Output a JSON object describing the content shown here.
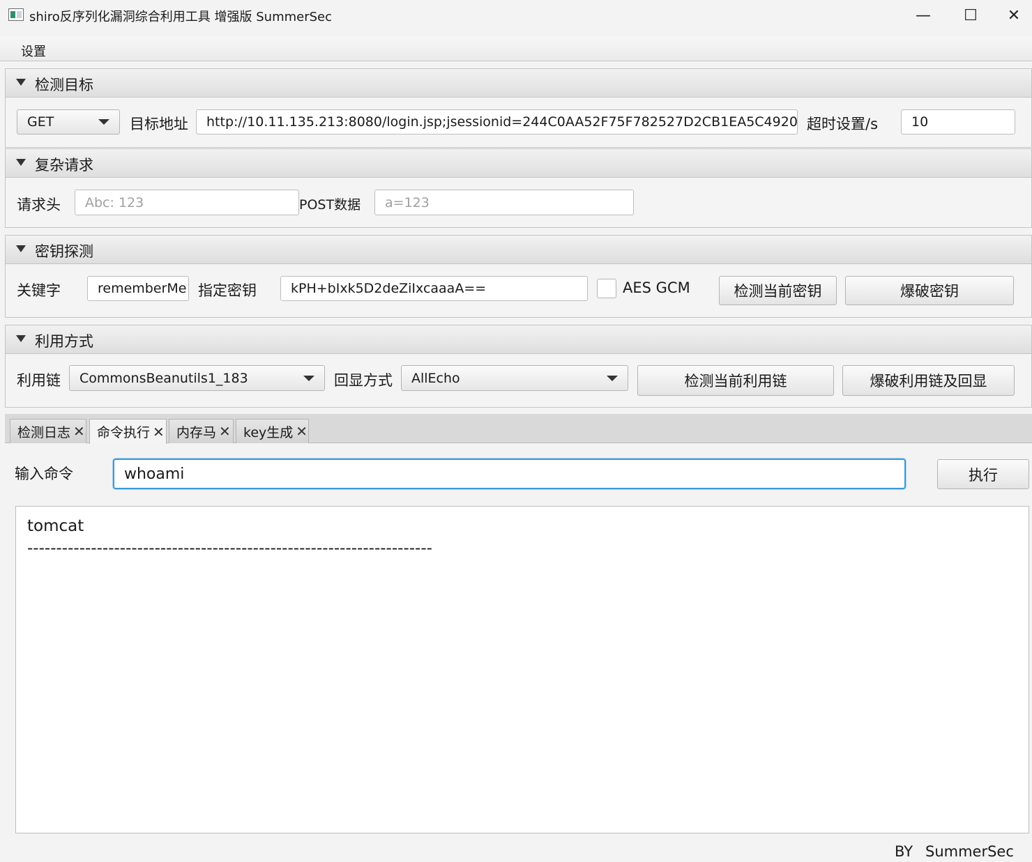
{
  "window": {
    "title": "shiro反序列化漏洞综合利用工具 增强版 SummerSec",
    "minimize_glyph": "—",
    "maximize_glyph": "☐",
    "close_glyph": "✕"
  },
  "menu": {
    "settings": "设置"
  },
  "target_pane": {
    "title": "检测目标",
    "method": "GET",
    "url_label": "目标地址",
    "url_value": "http://10.11.135.213:8080/login.jsp;jsessionid=244C0AA52F75F782527D2CB1EA5C4920",
    "timeout_label": "超时设置/s",
    "timeout_value": "10"
  },
  "complex_pane": {
    "title": "复杂请求",
    "header_label": "请求头",
    "header_placeholder": "Abc: 123",
    "post_label": "POST数据",
    "post_placeholder": "a=123"
  },
  "key_pane": {
    "title": "密钥探测",
    "keyword_label": "关键字",
    "keyword_value": "rememberMe",
    "key_label": "指定密钥",
    "key_value": "kPH+bIxk5D2deZiIxcaaaA==",
    "aes_gcm_label": "AES GCM",
    "aes_gcm_checked": false,
    "detect_key_button": "检测当前密钥",
    "brute_key_button": "爆破密钥"
  },
  "exploit_pane": {
    "title": "利用方式",
    "chain_label": "利用链",
    "chain_value": "CommonsBeanutils1_183",
    "echo_label": "回显方式",
    "echo_value": "AllEcho",
    "detect_chain_button": "检测当前利用链",
    "brute_chain_button": "爆破利用链及回显"
  },
  "tabs": [
    {
      "label": "检测日志",
      "active": false
    },
    {
      "label": "命令执行",
      "active": true
    },
    {
      "label": "内存马",
      "active": false
    },
    {
      "label": "key生成",
      "active": false
    }
  ],
  "tab_close_glyph": "✕",
  "command": {
    "label": "输入命令",
    "value": "whoami",
    "execute_button": "执行"
  },
  "output": {
    "lines": [
      "tomcat",
      "----------------------------------------------------------------------"
    ]
  },
  "footer": {
    "by": "BY",
    "author": "SummerSec"
  }
}
